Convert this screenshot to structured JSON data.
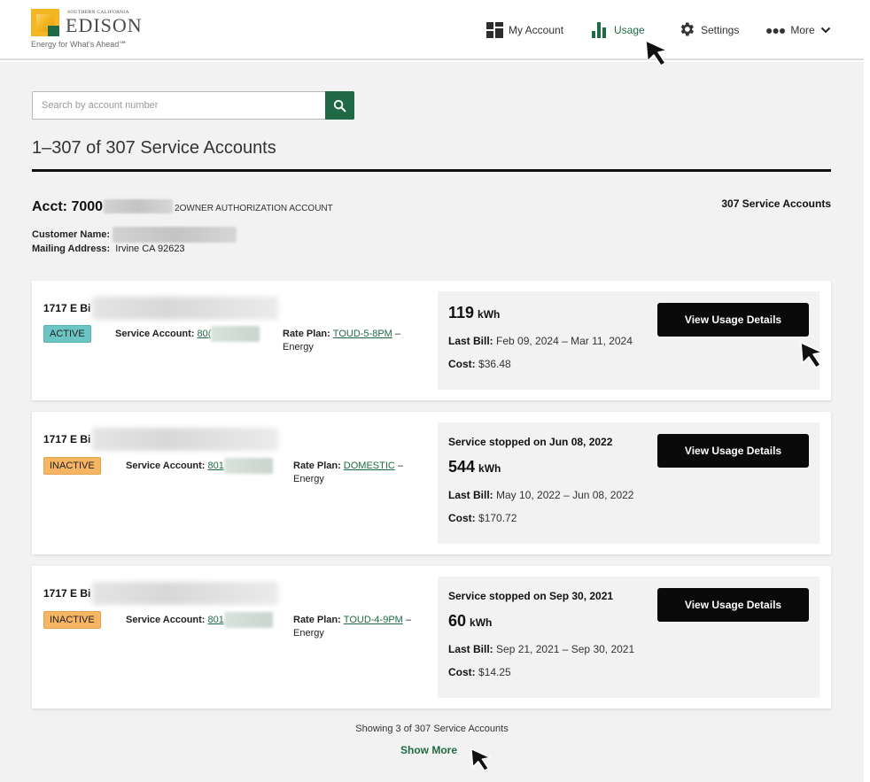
{
  "brand": {
    "small_text": "SOUTHERN CALIFORNIA",
    "name": "EDISON",
    "tagline": "Energy for What's Ahead℠"
  },
  "nav": {
    "my_account": "My Account",
    "usage": "Usage",
    "settings": "Settings",
    "more": "More"
  },
  "search": {
    "placeholder": "Search by account number"
  },
  "accounts_title": "1–307 of 307 Service Accounts",
  "account": {
    "label": "Acct: 7000",
    "type": "2OWNER AUTHORIZATION ACCOUNT",
    "service_count": "307 Service Accounts",
    "customer_name_label": "Customer Name:",
    "mailing_address_label": "Mailing Address:",
    "mailing_address": "Irvine CA 92623"
  },
  "labels": {
    "service_account": "Service Account:",
    "rate_plan": "Rate Plan:",
    "last_bill": "Last Bill:",
    "cost": "Cost:",
    "kwh_unit": "kWh",
    "view_usage_details": "View Usage Details"
  },
  "cards": [
    {
      "address": "1717 E Bi",
      "status": "ACTIVE",
      "service_account_partial": "80(",
      "rate_plan": "TOUD-5-8PM",
      "rate_suffix": " –",
      "rate_line2": "Energy",
      "stopped": "",
      "kwh": "119",
      "last_bill": "Feb 09, 2024 – Mar 11, 2024",
      "cost": "$36.48"
    },
    {
      "address": "1717 E Bi",
      "status": "INACTIVE",
      "service_account_partial": "801",
      "rate_plan": "DOMESTIC",
      "rate_suffix": " –",
      "rate_line2": "Energy",
      "stopped": "Service stopped on Jun 08, 2022",
      "kwh": "544",
      "last_bill": "May 10, 2022 – Jun 08, 2022",
      "cost": "$170.72"
    },
    {
      "address": "1717 E Bi",
      "status": "INACTIVE",
      "service_account_partial": "801",
      "rate_plan": "TOUD-4-9PM",
      "rate_suffix": " –",
      "rate_line2": "Energy",
      "stopped": "Service stopped on Sep 30, 2021",
      "kwh": "60",
      "last_bill": "Sep 21, 2021 – Sep 30, 2021",
      "cost": "$14.25"
    }
  ],
  "footer": {
    "showing": "Showing 3 of 307 Service Accounts",
    "show_more": "Show More"
  },
  "colors": {
    "brand_green": "#1f6a45",
    "active_badge": "#6cc5c5",
    "inactive_badge": "#f6b563",
    "button_black": "#0a0a0a",
    "logo_yellow": "#f4b623"
  },
  "icons": [
    "grid-icon",
    "bar-chart-icon",
    "gear-icon",
    "more-dots-icon",
    "chevron-down-icon",
    "search-icon",
    "mouse-cursor-icon"
  ]
}
